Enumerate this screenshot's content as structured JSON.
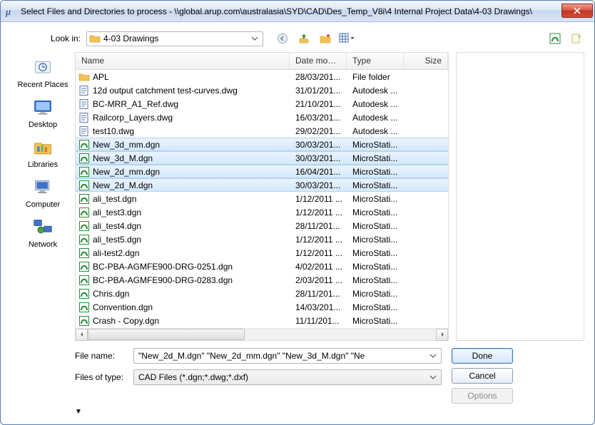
{
  "window": {
    "title": "Select Files and Directories to process - \\\\global.arup.com\\australasia\\SYD\\CAD\\Des_Temp_V8i\\4 Internal Project Data\\4-03 Drawings\\"
  },
  "look_in": {
    "label": "Look in:",
    "value": "4-03 Drawings"
  },
  "columns": {
    "name": "Name",
    "date": "Date modif...",
    "type": "Type",
    "size": "Size"
  },
  "places": [
    {
      "label": "Recent Places",
      "icon": "recent"
    },
    {
      "label": "Desktop",
      "icon": "desktop"
    },
    {
      "label": "Libraries",
      "icon": "libraries"
    },
    {
      "label": "Computer",
      "icon": "computer"
    },
    {
      "label": "Network",
      "icon": "network"
    }
  ],
  "files": [
    {
      "icon": "folder",
      "name": "APL",
      "date": "28/03/201...",
      "type": "File folder",
      "selected": false
    },
    {
      "icon": "dwg",
      "name": "12d output catchment test-curves.dwg",
      "date": "31/01/201...",
      "type": "Autodesk ...",
      "selected": false
    },
    {
      "icon": "dwg",
      "name": "BC-MRR_A1_Ref.dwg",
      "date": "21/10/201...",
      "type": "Autodesk ...",
      "selected": false
    },
    {
      "icon": "dwg",
      "name": "Railcorp_Layers.dwg",
      "date": "16/03/201...",
      "type": "Autodesk ...",
      "selected": false
    },
    {
      "icon": "dwg",
      "name": "test10.dwg",
      "date": "29/02/201...",
      "type": "Autodesk ...",
      "selected": false
    },
    {
      "icon": "dgn",
      "name": "New_3d_mm.dgn",
      "date": "30/03/201...",
      "type": "MicroStati...",
      "selected": true
    },
    {
      "icon": "dgn",
      "name": "New_3d_M.dgn",
      "date": "30/03/201...",
      "type": "MicroStati...",
      "selected": true
    },
    {
      "icon": "dgn",
      "name": "New_2d_mm.dgn",
      "date": "16/04/201...",
      "type": "MicroStati...",
      "selected": true
    },
    {
      "icon": "dgn",
      "name": "New_2d_M.dgn",
      "date": "30/03/201...",
      "type": "MicroStati...",
      "selected": true
    },
    {
      "icon": "dgn",
      "name": "ali_test.dgn",
      "date": "1/12/2011 ...",
      "type": "MicroStati...",
      "selected": false
    },
    {
      "icon": "dgn",
      "name": "ali_test3.dgn",
      "date": "1/12/2011 ...",
      "type": "MicroStati...",
      "selected": false
    },
    {
      "icon": "dgn",
      "name": "ali_test4.dgn",
      "date": "28/11/201...",
      "type": "MicroStati...",
      "selected": false
    },
    {
      "icon": "dgn",
      "name": "ali_test5.dgn",
      "date": "1/12/2011 ...",
      "type": "MicroStati...",
      "selected": false
    },
    {
      "icon": "dgn",
      "name": "ali-test2.dgn",
      "date": "1/12/2011 ...",
      "type": "MicroStati...",
      "selected": false
    },
    {
      "icon": "dgn",
      "name": "BC-PBA-AGMFE900-DRG-0251.dgn",
      "date": "4/02/2011 ...",
      "type": "MicroStati...",
      "selected": false
    },
    {
      "icon": "dgn",
      "name": "BC-PBA-AGMFE900-DRG-0283.dgn",
      "date": "2/03/2011 ...",
      "type": "MicroStati...",
      "selected": false
    },
    {
      "icon": "dgn",
      "name": "Chris.dgn",
      "date": "28/11/201...",
      "type": "MicroStati...",
      "selected": false
    },
    {
      "icon": "dgn",
      "name": "Convention.dgn",
      "date": "14/03/201...",
      "type": "MicroStati...",
      "selected": false
    },
    {
      "icon": "dgn",
      "name": "Crash - Copy.dgn",
      "date": "11/11/201...",
      "type": "MicroStati...",
      "selected": false
    }
  ],
  "file_name": {
    "label": "File name:",
    "value": "\"New_2d_M.dgn\" \"New_2d_mm.dgn\" \"New_3d_M.dgn\" \"Ne"
  },
  "files_of_type": {
    "label": "Files of type:",
    "value": "CAD Files (*.dgn;*.dwg;*.dxf)"
  },
  "buttons": {
    "done": "Done",
    "cancel": "Cancel",
    "options": "Options"
  },
  "icons": {
    "folder_color": "#f6c153",
    "dgn_color": "#2a8c3a",
    "dwg_color": "#5e7aa8"
  }
}
